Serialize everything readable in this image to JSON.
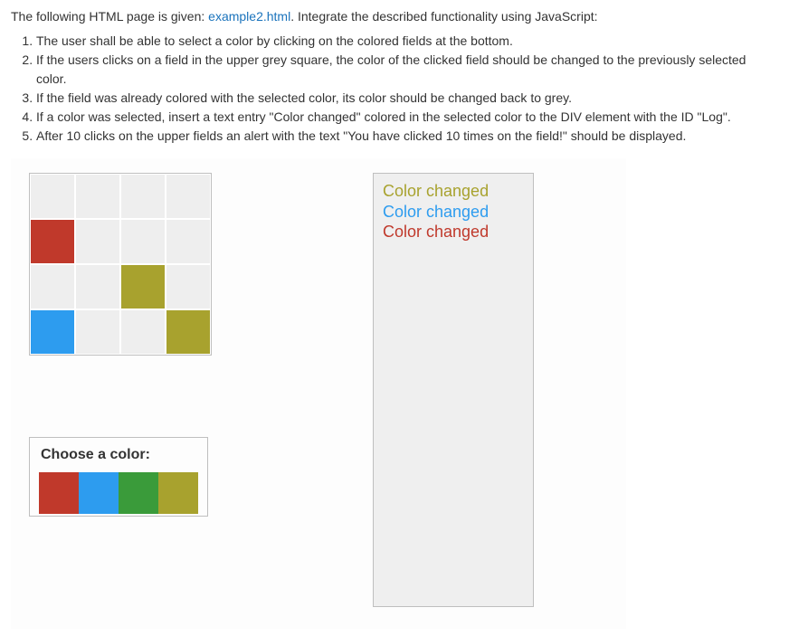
{
  "intro": {
    "prefix": "The following HTML page is given: ",
    "link": "example2.html",
    "suffix": ". Integrate the described functionality using JavaScript:"
  },
  "requirements": [
    "The user shall be able to select a color by clicking on the colored fields at the bottom.",
    "If the users clicks on a field in the upper grey square, the color of the clicked field should be changed to the previously selected color.",
    "If the field was already colored with the selected color, its color should be changed back to grey.",
    "If a color was selected, insert a text entry \"Color changed\" colored in the selected color to the DIV element with the ID \"Log\".",
    "After 10 clicks on the upper fields an alert with the text \"You have clicked 10 times on the field!\" should be displayed."
  ],
  "colors": {
    "grey": "#eeeeee",
    "red": "#c0392b",
    "blue": "#2d9cef",
    "green": "#3a9b3a",
    "olive": "#a8a22e"
  },
  "grid": {
    "rows": 4,
    "cols": 4,
    "cells": [
      "grey",
      "grey",
      "grey",
      "grey",
      "red",
      "grey",
      "grey",
      "grey",
      "grey",
      "grey",
      "olive",
      "grey",
      "blue",
      "grey",
      "grey",
      "olive"
    ]
  },
  "chooser": {
    "title": "Choose a color:",
    "swatches": [
      "red",
      "blue",
      "green",
      "olive"
    ]
  },
  "log": {
    "entries": [
      {
        "text": "Color changed",
        "color": "olive"
      },
      {
        "text": "Color changed",
        "color": "blue"
      },
      {
        "text": "Color changed",
        "color": "red"
      }
    ]
  }
}
